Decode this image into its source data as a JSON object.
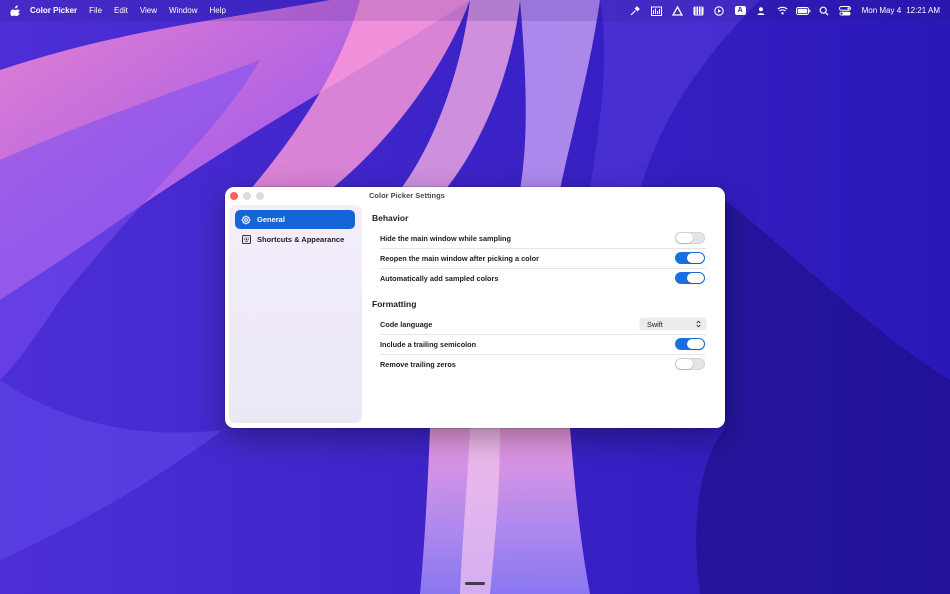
{
  "menubar": {
    "app_name": "Color Picker",
    "menus": [
      "File",
      "Edit",
      "View",
      "Window",
      "Help"
    ],
    "status_icons": [
      "eyedropper-icon",
      "audio-bars-icon",
      "triangle-app-icon",
      "piano-keys-icon",
      "play-circle-icon",
      "keyboard-input-a-icon",
      "person-icon",
      "wifi-icon",
      "battery-icon",
      "search-icon",
      "control-center-icon"
    ],
    "input_source": "A",
    "date": "Mon May 4",
    "time": "12:21 AM"
  },
  "window": {
    "title": "Color Picker Settings",
    "sidebar": {
      "items": [
        {
          "label": "General",
          "icon": "gear-icon",
          "selected": true
        },
        {
          "label": "Shortcuts & Appearance",
          "icon": "keyboard-icon",
          "selected": false
        }
      ]
    },
    "sections": [
      {
        "title": "Behavior",
        "rows": [
          {
            "label": "Hide the main window while sampling",
            "control": "toggle",
            "on": false
          },
          {
            "label": "Reopen the main window after picking a color",
            "control": "toggle",
            "on": true
          },
          {
            "label": "Automatically add sampled colors",
            "control": "toggle",
            "on": true
          }
        ]
      },
      {
        "title": "Formatting",
        "rows": [
          {
            "label": "Code language",
            "control": "select",
            "value": "Swift"
          },
          {
            "label": "Include a trailing semicolon",
            "control": "toggle",
            "on": true
          },
          {
            "label": "Remove trailing zeros",
            "control": "toggle",
            "on": false
          }
        ]
      }
    ]
  },
  "colors": {
    "accent": "#1a6fe0",
    "sidebar_selected": "#1565d8",
    "close_button": "#ff5f57",
    "toggle_off": "#e4e4e6"
  }
}
